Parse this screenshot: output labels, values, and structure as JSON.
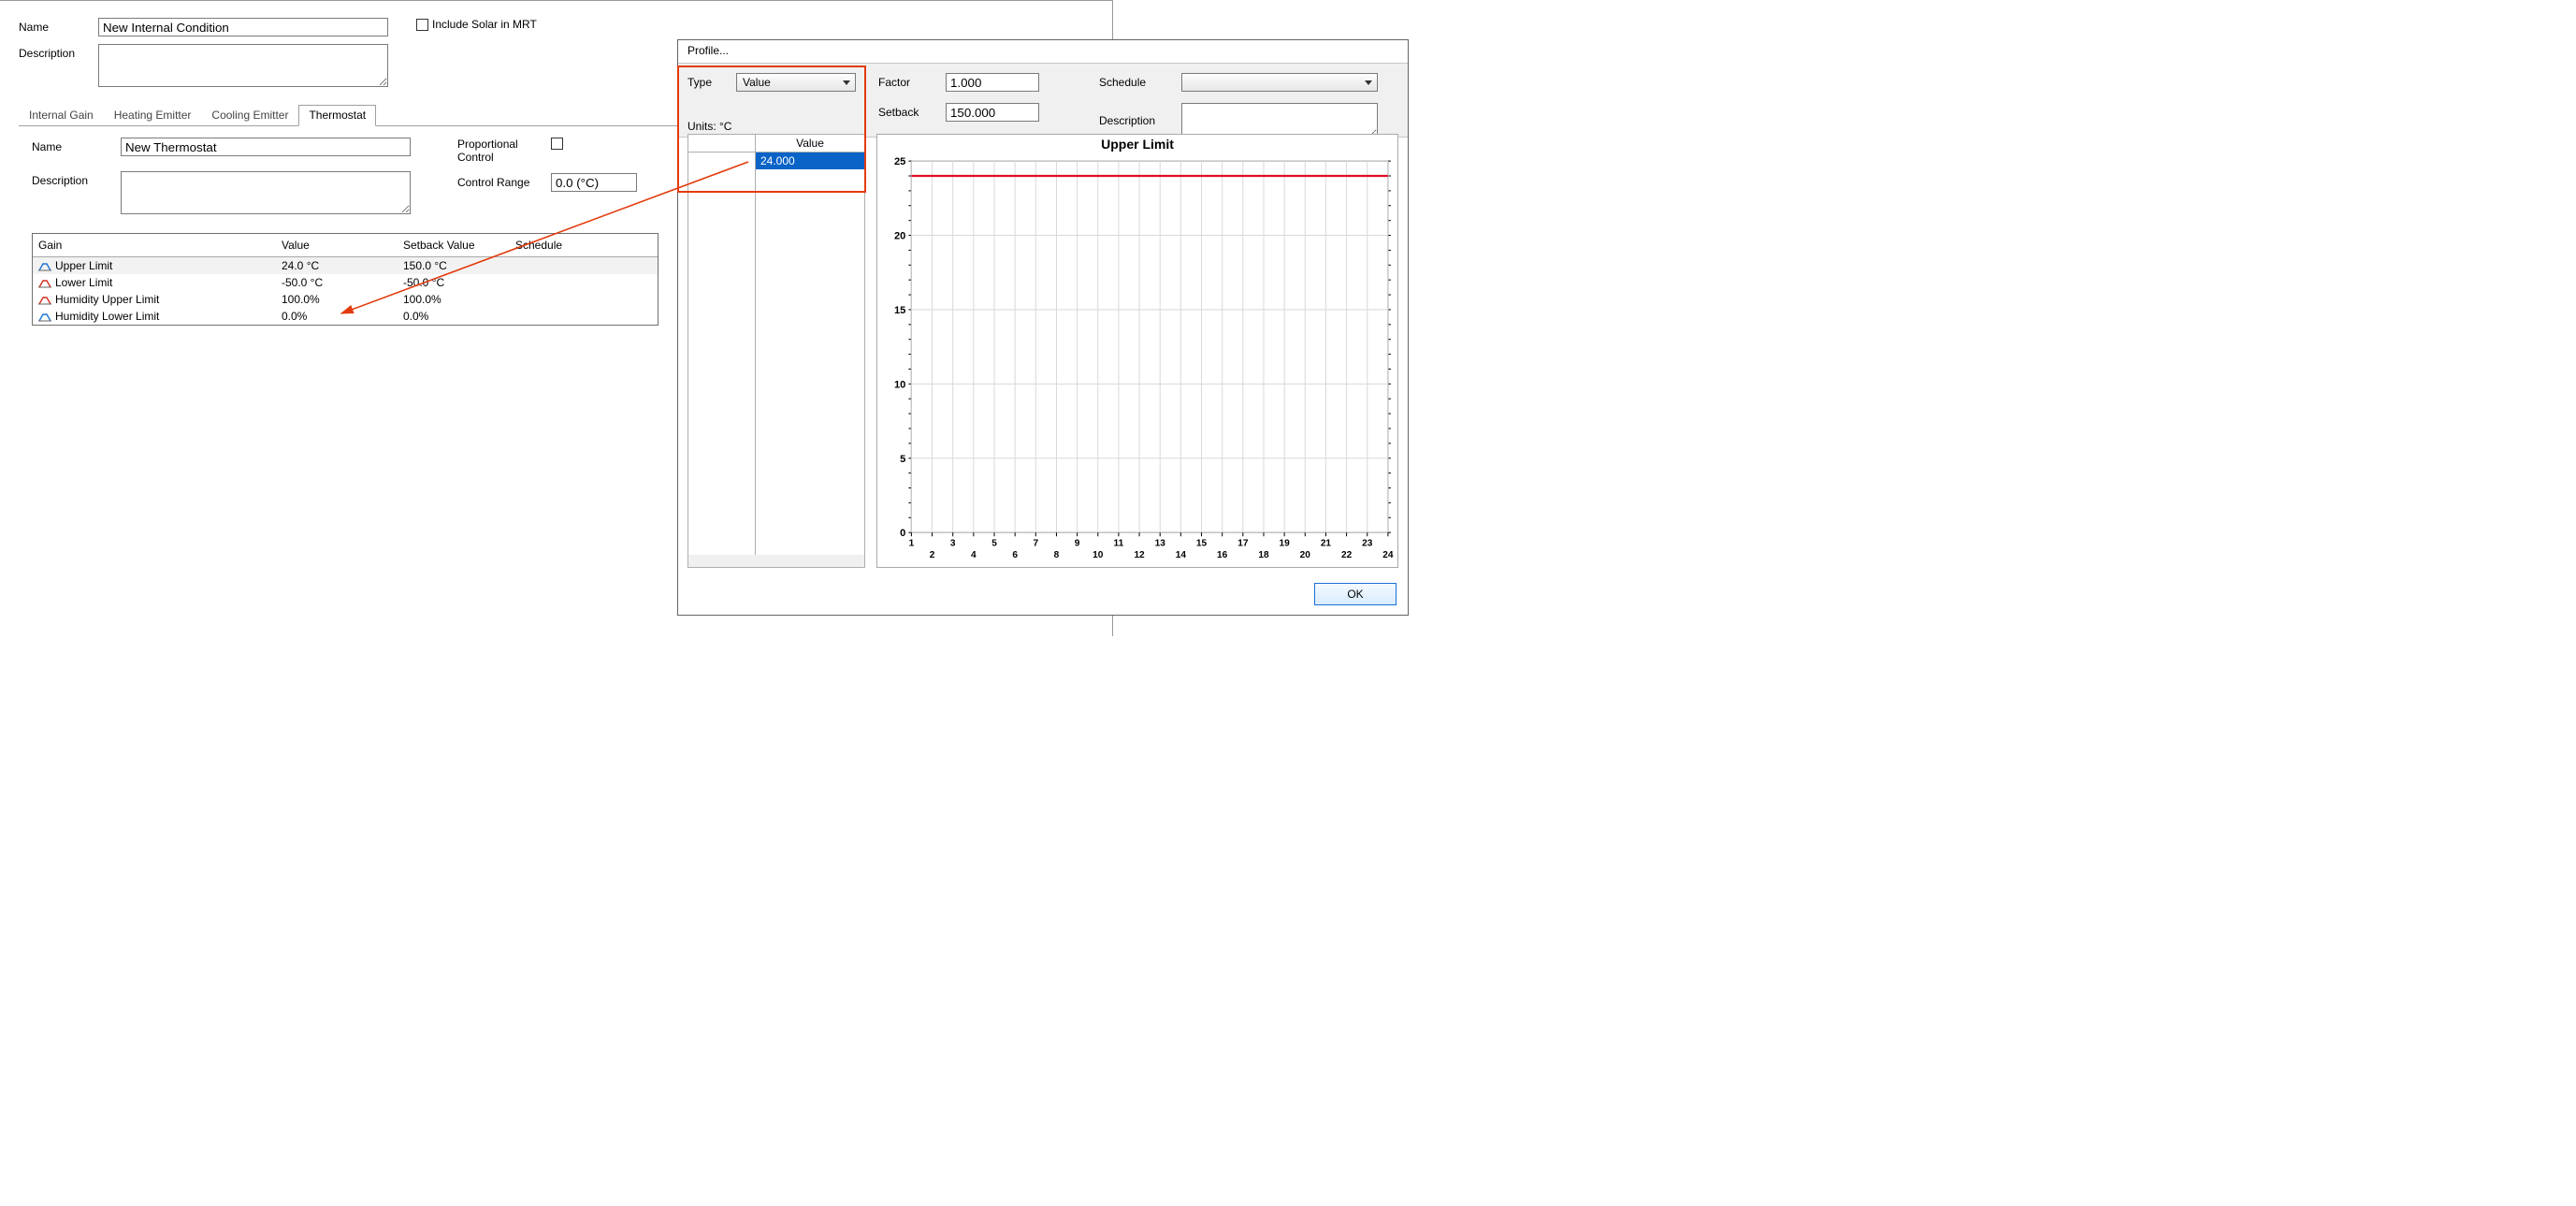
{
  "main": {
    "name_label": "Name",
    "name_value": "New Internal Condition",
    "desc_label": "Description",
    "desc_value": "",
    "include_solar_label": "Include Solar in MRT",
    "tabs": {
      "internal_gain": "Internal Gain",
      "heating_emitter": "Heating Emitter",
      "cooling_emitter": "Cooling Emitter",
      "thermostat": "Thermostat"
    },
    "thermo": {
      "name_label": "Name",
      "name_value": "New Thermostat",
      "desc_label": "Description",
      "desc_value": "",
      "prop_ctrl_label": "Proportional Control",
      "ctrl_range_label": "Control Range",
      "ctrl_range_value": "0.0 (°C)",
      "grid": {
        "headers": {
          "gain": "Gain",
          "value": "Value",
          "setback": "Setback Value",
          "schedule": "Schedule"
        },
        "rows": [
          {
            "gain": "Upper Limit",
            "value": "24.0 °C",
            "setback": "150.0 °C",
            "schedule": "",
            "color": "#1e73d6"
          },
          {
            "gain": "Lower Limit",
            "value": "-50.0 °C",
            "setback": "-50.0 °C",
            "schedule": "",
            "color": "#d62f1e"
          },
          {
            "gain": "Humidity Upper Limit",
            "value": "100.0%",
            "setback": "100.0%",
            "schedule": "",
            "color": "#d62f1e"
          },
          {
            "gain": "Humidity Lower Limit",
            "value": "0.0%",
            "setback": "0.0%",
            "schedule": "",
            "color": "#1e73d6"
          }
        ]
      }
    }
  },
  "profile": {
    "title": "Profile...",
    "type_label": "Type",
    "type_value": "Value",
    "units_label": "Units: °C",
    "factor_label": "Factor",
    "factor_value": "1.000",
    "setback_label": "Setback",
    "setback_value": "150.000",
    "schedule_label": "Schedule",
    "schedule_value": "",
    "description_label": "Description",
    "description_value": "",
    "value_header": "Value",
    "value_cell": "24.000",
    "ok": "OK"
  },
  "chart_data": {
    "type": "line",
    "title": "Upper Limit",
    "xlabel": "",
    "ylabel": "",
    "x": [
      1,
      2,
      3,
      4,
      5,
      6,
      7,
      8,
      9,
      10,
      11,
      12,
      13,
      14,
      15,
      16,
      17,
      18,
      19,
      20,
      21,
      22,
      23,
      24
    ],
    "series": [
      {
        "name": "Upper Limit",
        "color": "#e30c23",
        "values": [
          24,
          24,
          24,
          24,
          24,
          24,
          24,
          24,
          24,
          24,
          24,
          24,
          24,
          24,
          24,
          24,
          24,
          24,
          24,
          24,
          24,
          24,
          24,
          24
        ]
      }
    ],
    "ylim": [
      0,
      25
    ],
    "yticks": [
      0,
      5,
      10,
      15,
      20,
      25
    ],
    "xticks": [
      1,
      2,
      3,
      4,
      5,
      6,
      7,
      8,
      9,
      10,
      11,
      12,
      13,
      14,
      15,
      16,
      17,
      18,
      19,
      20,
      21,
      22,
      23,
      24
    ]
  }
}
